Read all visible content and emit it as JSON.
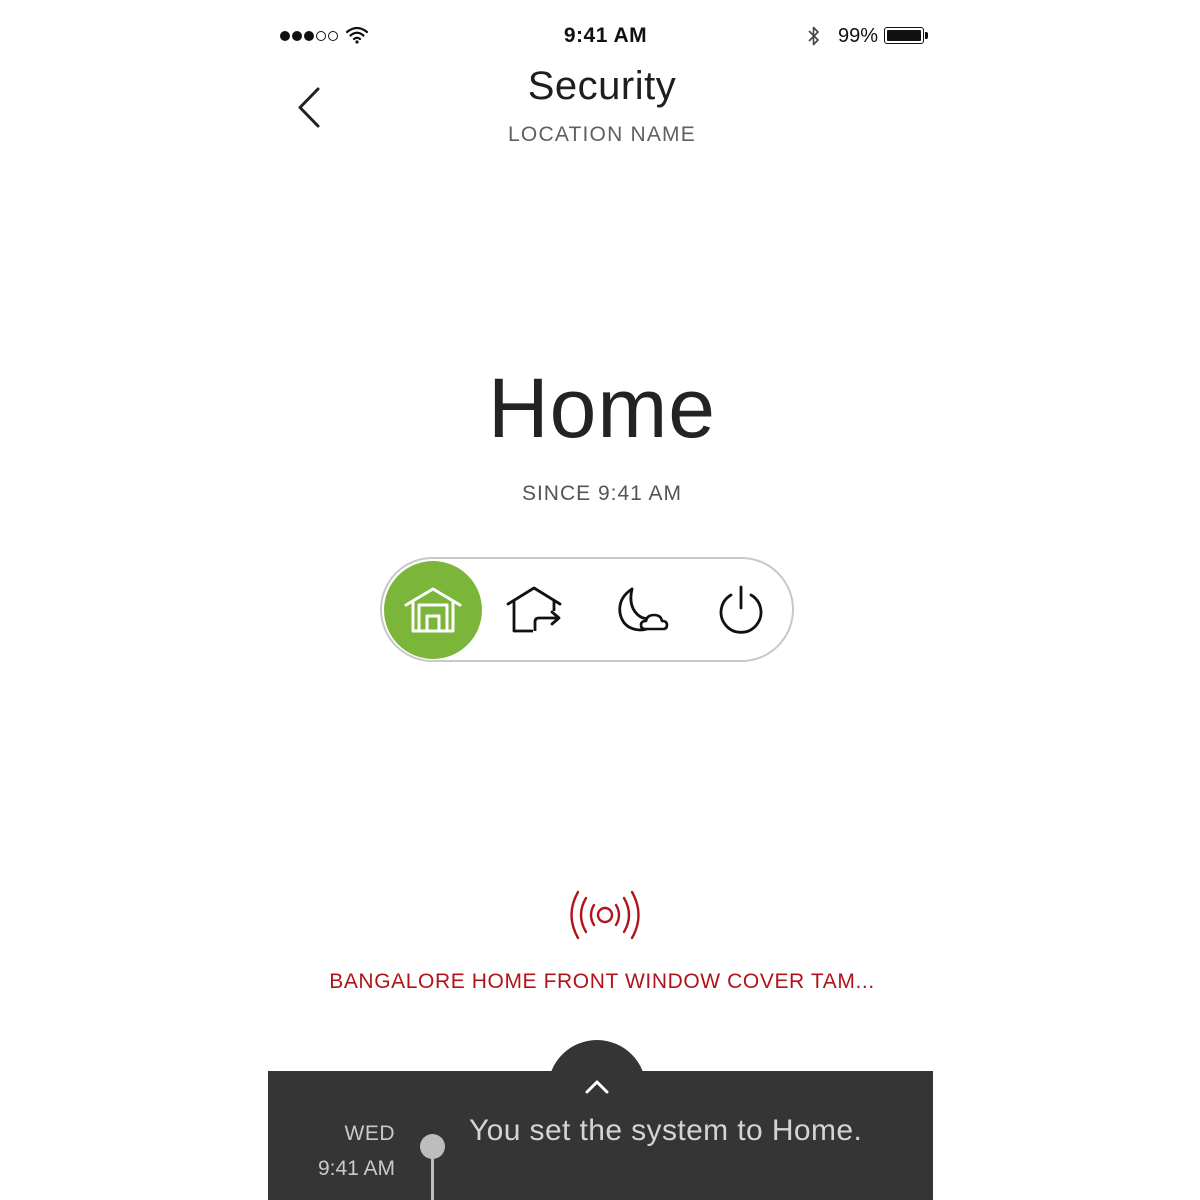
{
  "status_bar": {
    "time": "9:41 AM",
    "battery_percent": "99%",
    "signal_bars_filled": 3,
    "signal_bars_total": 5,
    "icons": [
      "signal-dots-icon",
      "wifi-icon",
      "bluetooth-icon",
      "battery-icon"
    ]
  },
  "header": {
    "title": "Security",
    "subtitle": "LOCATION NAME",
    "back_icon": "chevron-left-icon"
  },
  "mode": {
    "current": "Home",
    "since": "SINCE 9:41 AM"
  },
  "arm_selector": {
    "active_index": 0,
    "active_color": "#7bb53a",
    "options": [
      {
        "icon": "home-icon"
      },
      {
        "icon": "away-icon"
      },
      {
        "icon": "night-icon"
      },
      {
        "icon": "power-icon"
      }
    ]
  },
  "alert": {
    "icon": "alarm-signal-icon",
    "text": "BANGALORE HOME FRONT WINDOW COVER TAM...",
    "color": "#b0141a"
  },
  "drawer": {
    "expand_icon": "chevron-up-icon",
    "background_color": "#353535",
    "event": {
      "day": "WED",
      "time": "9:41 AM",
      "message": "You set the system to Home."
    }
  }
}
